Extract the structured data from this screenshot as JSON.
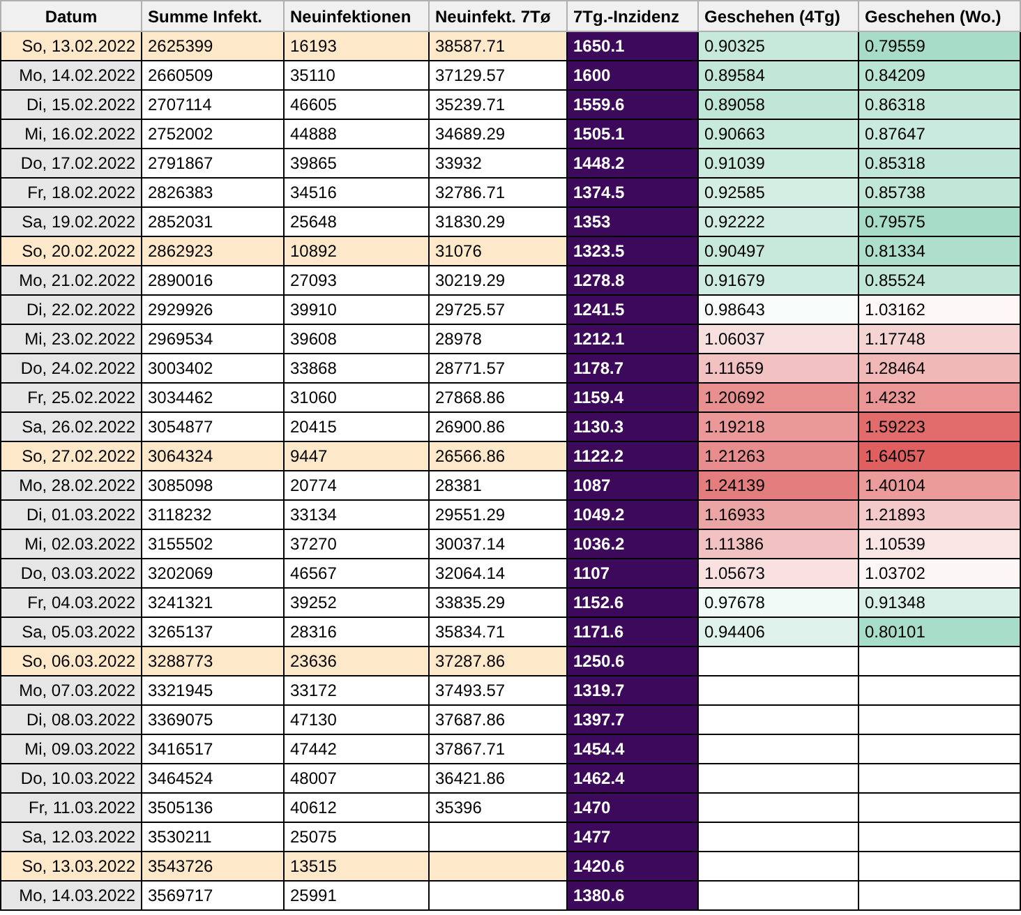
{
  "table": {
    "columns": [
      "Datum",
      "Summe Infekt.",
      "Neuinfektionen",
      "Neuinfekt. 7Tø",
      "7Tg.-Inzidenz",
      "Geschehen (4Tg)",
      "Geschehen (Wo.)"
    ],
    "rows": [
      {
        "date": "So, 13.02.2022",
        "highlighted": true,
        "total": "2625399",
        "new": "16193",
        "avg_7d": "38587.71",
        "incidence": "1650.1",
        "trend_4d": {
          "value": "0.90325",
          "color": "#c6e9dc"
        },
        "trend_week": {
          "value": "0.79559",
          "color": "#a6dcc8"
        }
      },
      {
        "date": "Mo, 14.02.2022",
        "highlighted": false,
        "total": "2660509",
        "new": "35110",
        "avg_7d": "37129.57",
        "incidence": "1600",
        "trend_4d": {
          "value": "0.89584",
          "color": "#c2e7d9"
        },
        "trend_week": {
          "value": "0.84209",
          "color": "#bae4d4"
        }
      },
      {
        "date": "Di, 15.02.2022",
        "highlighted": false,
        "total": "2707114",
        "new": "46605",
        "avg_7d": "35239.71",
        "incidence": "1559.6",
        "trend_4d": {
          "value": "0.89058",
          "color": "#bfe6d7"
        },
        "trend_week": {
          "value": "0.86318",
          "color": "#c3e8da"
        }
      },
      {
        "date": "Mi, 16.02.2022",
        "highlighted": false,
        "total": "2752002",
        "new": "44888",
        "avg_7d": "34689.29",
        "incidence": "1505.1",
        "trend_4d": {
          "value": "0.90663",
          "color": "#c8eadd"
        },
        "trend_week": {
          "value": "0.87647",
          "color": "#c9eade"
        }
      },
      {
        "date": "Do, 17.02.2022",
        "highlighted": false,
        "total": "2791867",
        "new": "39865",
        "avg_7d": "33932",
        "incidence": "1448.2",
        "trend_4d": {
          "value": "0.91039",
          "color": "#cbebde"
        },
        "trend_week": {
          "value": "0.85318",
          "color": "#bfe6d8"
        }
      },
      {
        "date": "Fr, 18.02.2022",
        "highlighted": false,
        "total": "2826383",
        "new": "34516",
        "avg_7d": "32786.71",
        "incidence": "1374.5",
        "trend_4d": {
          "value": "0.92585",
          "color": "#d4eee4"
        },
        "trend_week": {
          "value": "0.85738",
          "color": "#c1e7d9"
        }
      },
      {
        "date": "Sa, 19.02.2022",
        "highlighted": false,
        "total": "2852031",
        "new": "25648",
        "avg_7d": "31830.29",
        "incidence": "1353",
        "trend_4d": {
          "value": "0.92222",
          "color": "#d1ede3"
        },
        "trend_week": {
          "value": "0.79575",
          "color": "#a6dcc8"
        }
      },
      {
        "date": "So, 20.02.2022",
        "highlighted": true,
        "total": "2862923",
        "new": "10892",
        "avg_7d": "31076",
        "incidence": "1323.5",
        "trend_4d": {
          "value": "0.90497",
          "color": "#c7e9dc"
        },
        "trend_week": {
          "value": "0.81334",
          "color": "#aedfcd"
        }
      },
      {
        "date": "Mo, 21.02.2022",
        "highlighted": false,
        "total": "2890016",
        "new": "27093",
        "avg_7d": "30219.29",
        "incidence": "1278.8",
        "trend_4d": {
          "value": "0.91679",
          "color": "#ceece1"
        },
        "trend_week": {
          "value": "0.85524",
          "color": "#c0e6d8"
        }
      },
      {
        "date": "Di, 22.02.2022",
        "highlighted": false,
        "total": "2929926",
        "new": "39910",
        "avg_7d": "29725.57",
        "incidence": "1241.5",
        "trend_4d": {
          "value": "0.98643",
          "color": "#f7fcfa"
        },
        "trend_week": {
          "value": "1.03162",
          "color": "#fdf7f7"
        }
      },
      {
        "date": "Mi, 23.02.2022",
        "highlighted": false,
        "total": "2969534",
        "new": "39608",
        "avg_7d": "28978",
        "incidence": "1212.1",
        "trend_4d": {
          "value": "1.06037",
          "color": "#f8dfdf"
        },
        "trend_week": {
          "value": "1.17748",
          "color": "#f6d3d3"
        }
      },
      {
        "date": "Do, 24.02.2022",
        "highlighted": false,
        "total": "3003402",
        "new": "33868",
        "avg_7d": "28771.57",
        "incidence": "1178.7",
        "trend_4d": {
          "value": "1.11659",
          "color": "#f2c1c1"
        },
        "trend_week": {
          "value": "1.28464",
          "color": "#f1b8b8"
        }
      },
      {
        "date": "Fr, 25.02.2022",
        "highlighted": false,
        "total": "3034462",
        "new": "31060",
        "avg_7d": "27868.86",
        "incidence": "1159.4",
        "trend_4d": {
          "value": "1.20692",
          "color": "#e89090"
        },
        "trend_week": {
          "value": "1.4232",
          "color": "#eb9696"
        }
      },
      {
        "date": "Sa, 26.02.2022",
        "highlighted": false,
        "total": "3054877",
        "new": "20415",
        "avg_7d": "26900.86",
        "incidence": "1130.3",
        "trend_4d": {
          "value": "1.19218",
          "color": "#ea9898"
        },
        "trend_week": {
          "value": "1.59223",
          "color": "#e26c6c"
        }
      },
      {
        "date": "So, 27.02.2022",
        "highlighted": true,
        "total": "3064324",
        "new": "9447",
        "avg_7d": "26566.86",
        "incidence": "1122.2",
        "trend_4d": {
          "value": "1.21263",
          "color": "#e78d8d"
        },
        "trend_week": {
          "value": "1.64057",
          "color": "#e06060"
        }
      },
      {
        "date": "Mo, 28.02.2022",
        "highlighted": false,
        "total": "3085098",
        "new": "20774",
        "avg_7d": "28381",
        "incidence": "1087",
        "trend_4d": {
          "value": "1.24139",
          "color": "#e47e7e"
        },
        "trend_week": {
          "value": "1.40104",
          "color": "#ec9b9b"
        }
      },
      {
        "date": "Di, 01.03.2022",
        "highlighted": false,
        "total": "3118232",
        "new": "33134",
        "avg_7d": "29551.29",
        "incidence": "1049.2",
        "trend_4d": {
          "value": "1.16933",
          "color": "#eca5a5"
        },
        "trend_week": {
          "value": "1.21893",
          "color": "#f4c9c9"
        }
      },
      {
        "date": "Mi, 02.03.2022",
        "highlighted": false,
        "total": "3155502",
        "new": "37270",
        "avg_7d": "30037.14",
        "incidence": "1036.2",
        "trend_4d": {
          "value": "1.11386",
          "color": "#f2c2c2"
        },
        "trend_week": {
          "value": "1.10539",
          "color": "#fae5e5"
        }
      },
      {
        "date": "Do, 03.03.2022",
        "highlighted": false,
        "total": "3202069",
        "new": "46567",
        "avg_7d": "32064.14",
        "incidence": "1107",
        "trend_4d": {
          "value": "1.05673",
          "color": "#f9e1e1"
        },
        "trend_week": {
          "value": "1.03702",
          "color": "#fdf6f6"
        }
      },
      {
        "date": "Fr, 04.03.2022",
        "highlighted": false,
        "total": "3241321",
        "new": "39252",
        "avg_7d": "33835.29",
        "incidence": "1152.6",
        "trend_4d": {
          "value": "0.97678",
          "color": "#f1faf7"
        },
        "trend_week": {
          "value": "0.91348",
          "color": "#d9f0e8"
        }
      },
      {
        "date": "Sa, 05.03.2022",
        "highlighted": false,
        "total": "3265137",
        "new": "28316",
        "avg_7d": "35834.71",
        "incidence": "1171.6",
        "trend_4d": {
          "value": "0.94406",
          "color": "#def2eb"
        },
        "trend_week": {
          "value": "0.80101",
          "color": "#a8ddc9"
        }
      },
      {
        "date": "So, 06.03.2022",
        "highlighted": true,
        "total": "3288773",
        "new": "23636",
        "avg_7d": "37287.86",
        "incidence": "1250.6"
      },
      {
        "date": "Mo, 07.03.2022",
        "highlighted": false,
        "total": "3321945",
        "new": "33172",
        "avg_7d": "37493.57",
        "incidence": "1319.7"
      },
      {
        "date": "Di, 08.03.2022",
        "highlighted": false,
        "total": "3369075",
        "new": "47130",
        "avg_7d": "37687.86",
        "incidence": "1397.7"
      },
      {
        "date": "Mi, 09.03.2022",
        "highlighted": false,
        "total": "3416517",
        "new": "47442",
        "avg_7d": "37867.71",
        "incidence": "1454.4"
      },
      {
        "date": "Do, 10.03.2022",
        "highlighted": false,
        "total": "3464524",
        "new": "48007",
        "avg_7d": "36421.86",
        "incidence": "1462.4"
      },
      {
        "date": "Fr, 11.03.2022",
        "highlighted": false,
        "total": "3505136",
        "new": "40612",
        "avg_7d": "35396",
        "incidence": "1470"
      },
      {
        "date": "Sa, 12.03.2022",
        "highlighted": false,
        "total": "3530211",
        "new": "25075",
        "incidence": "1477"
      },
      {
        "date": "So, 13.03.2022",
        "highlighted": true,
        "total": "3543726",
        "new": "13515",
        "incidence": "1420.6"
      },
      {
        "date": "Mo, 14.03.2022",
        "highlighted": false,
        "total": "3569717",
        "new": "25991",
        "incidence": "1380.6"
      }
    ]
  }
}
